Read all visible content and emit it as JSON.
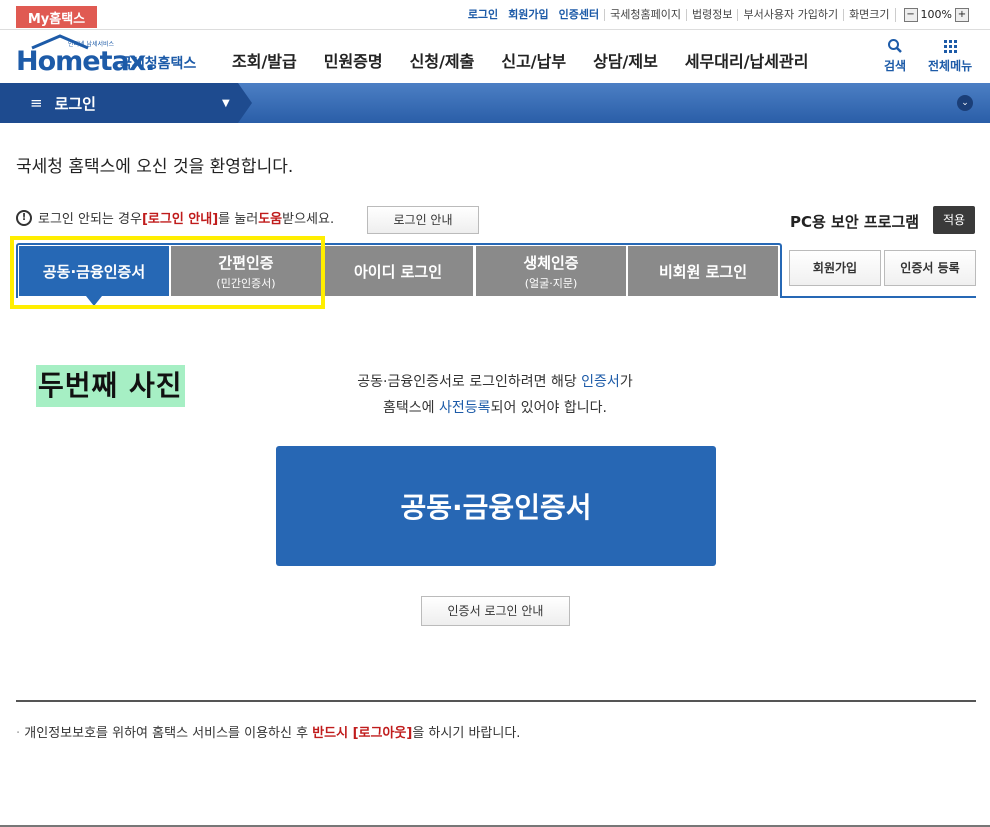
{
  "topbar": {
    "my_tab": "My홈택스",
    "links_blue": [
      "로그인",
      "회원가입",
      "인증센터"
    ],
    "links": [
      "국세청홈페이지",
      "법령정보",
      "부서사용자 가입하기",
      "화면크기"
    ],
    "zoom_minus": "−",
    "zoom_value": "100%",
    "zoom_plus": "+"
  },
  "header": {
    "logo_tiny": "인터넷 납세서비스",
    "logo_main": "Hometax.",
    "logo_sub": "국세청홈택스",
    "gnb": [
      "조회/발급",
      "민원증명",
      "신청/제출",
      "신고/납부",
      "상담/제보",
      "세무대리/납세관리"
    ],
    "search_label": "검색",
    "menu_label": "전체메뉴"
  },
  "navbar": {
    "menu_icon": "≡",
    "label": "로그인",
    "caret": "▼",
    "right_btn": "⌄"
  },
  "main": {
    "welcome": "국세청 홈택스에 오신 것을 환영합니다.",
    "help_prefix": "로그인 안되는 경우 ",
    "help_link": "[로그인 안내]",
    "help_mid": "를 눌러 ",
    "help_link2": "도움",
    "help_suffix": "받으세요.",
    "guide_button": "로그인 안내",
    "security_program": "PC용 보안 프로그램",
    "apply_button": "적용",
    "tabs": [
      {
        "label": "공동·금융인증서",
        "sub": ""
      },
      {
        "label": "간편인증",
        "sub": "(민간인증서)"
      },
      {
        "label": "아이디 로그인",
        "sub": ""
      },
      {
        "label": "생체인증",
        "sub": "(얼굴·지문)"
      },
      {
        "label": "비회원 로그인",
        "sub": ""
      }
    ],
    "signup_button": "회원가입",
    "cert_register_button": "인증서 등록",
    "note_label": "두번째 사진",
    "desc_line1_a": "공동·금융인증서로 로그인하려면 해당 ",
    "desc_line1_b": "인증서",
    "desc_line1_c": "가",
    "desc_line2_a": "홈택스에 ",
    "desc_line2_b": "사전등록",
    "desc_line2_c": "되어 있어야 합니다.",
    "big_button": "공동·금융인증서",
    "cert_guide_button": "인증서 로그인 안내",
    "footer_prefix": "개인정보보호를 위하여 홈택스 서비스를 이용하신 후 ",
    "footer_emph": "반드시 [로그아웃]",
    "footer_suffix": "을 하시기 바랍니다."
  }
}
